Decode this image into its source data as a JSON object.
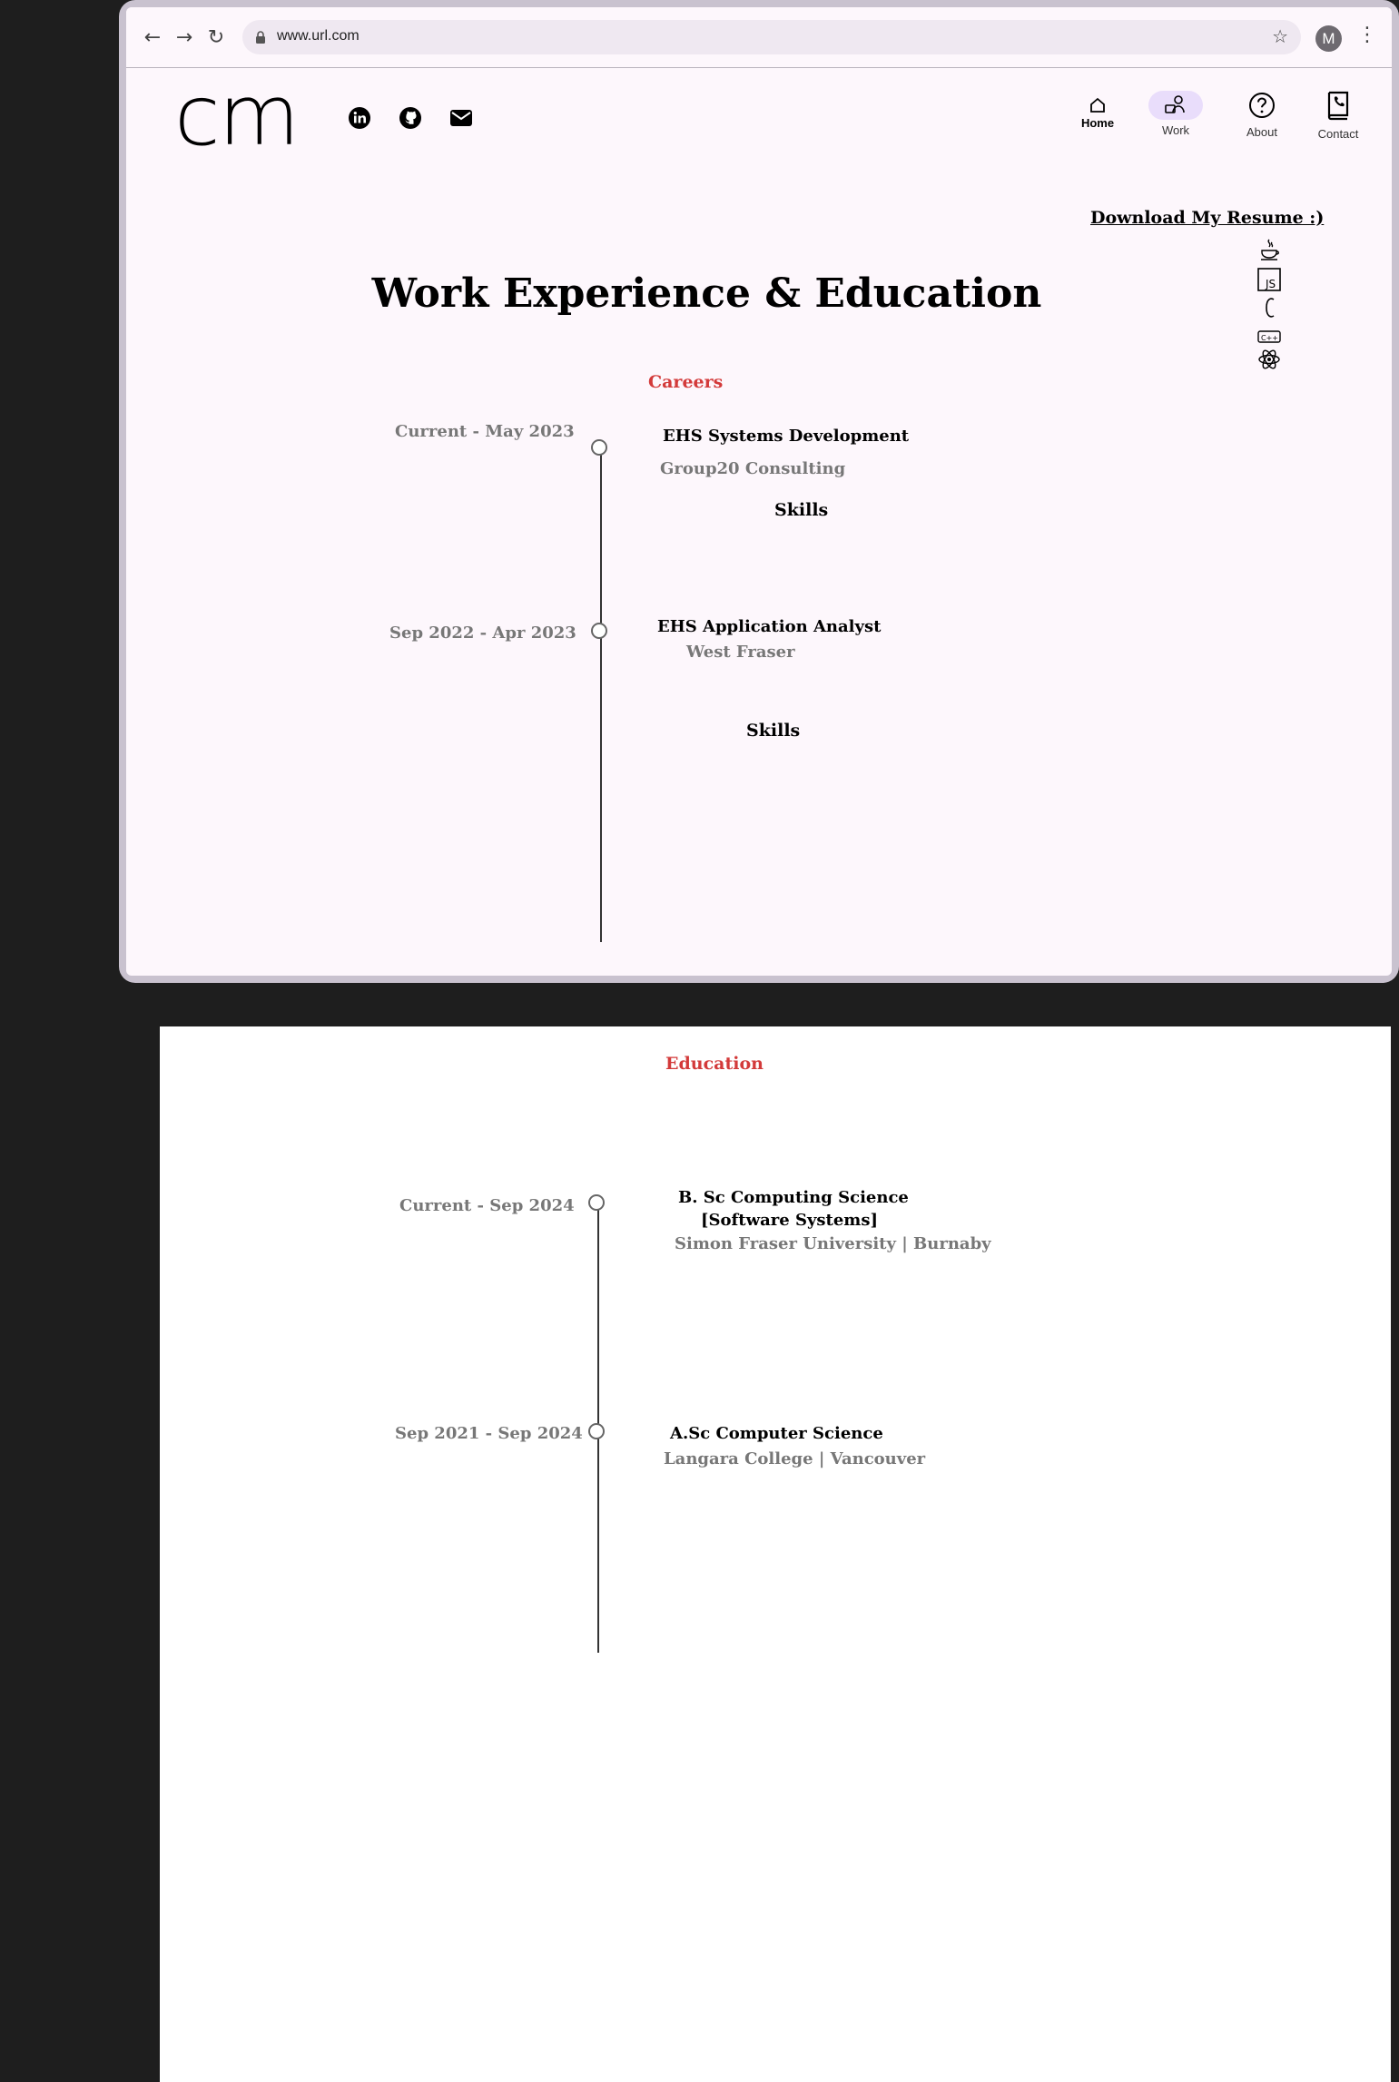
{
  "browser": {
    "url": "www.url.com",
    "profile_initial": "M",
    "icons": [
      "back-arrow-icon",
      "forward-arrow-icon",
      "reload-icon",
      "lock-icon",
      "star-icon",
      "kebab-menu-icon"
    ]
  },
  "header": {
    "logo": "cm",
    "social": [
      "linkedin-icon",
      "github-icon",
      "mail-icon"
    ],
    "nav": [
      {
        "label": "Home",
        "icon": "home-icon"
      },
      {
        "label": "Work",
        "icon": "work-icon",
        "active": true
      },
      {
        "label": "About",
        "icon": "question-icon"
      },
      {
        "label": "Contact",
        "icon": "phone-book-icon"
      }
    ]
  },
  "resume_link": "Download My Resume :)",
  "skill_icons": [
    "java-icon",
    "javascript-icon",
    "c-icon",
    "cpp-icon",
    "react-icon"
  ],
  "page_title": "Work Experience & Education",
  "careers": {
    "label": "Careers",
    "items": [
      {
        "date": "Current - May 2023",
        "role": "EHS Systems Development",
        "org": "Group20 Consulting",
        "skills": "Skills"
      },
      {
        "date": "Sep 2022 - Apr 2023",
        "role": "EHS Application Analyst",
        "org": "West Fraser",
        "skills": "Skills"
      }
    ]
  },
  "education": {
    "label": "Education",
    "items": [
      {
        "date": "Current - Sep 2024",
        "degree_line1": "B. Sc Computing Science",
        "degree_line2": "[Software Systems]",
        "school": "Simon Fraser University | Burnaby"
      },
      {
        "date": "Sep 2021 - Sep 2024",
        "degree_line1": "A.Sc Computer Science",
        "school": "Langara College | Vancouver"
      }
    ]
  },
  "colors": {
    "accent_red": "#d33a3a",
    "page_bg": "#fdf7fc",
    "nav_active": "#e9ddfb",
    "muted_text": "#777777"
  }
}
